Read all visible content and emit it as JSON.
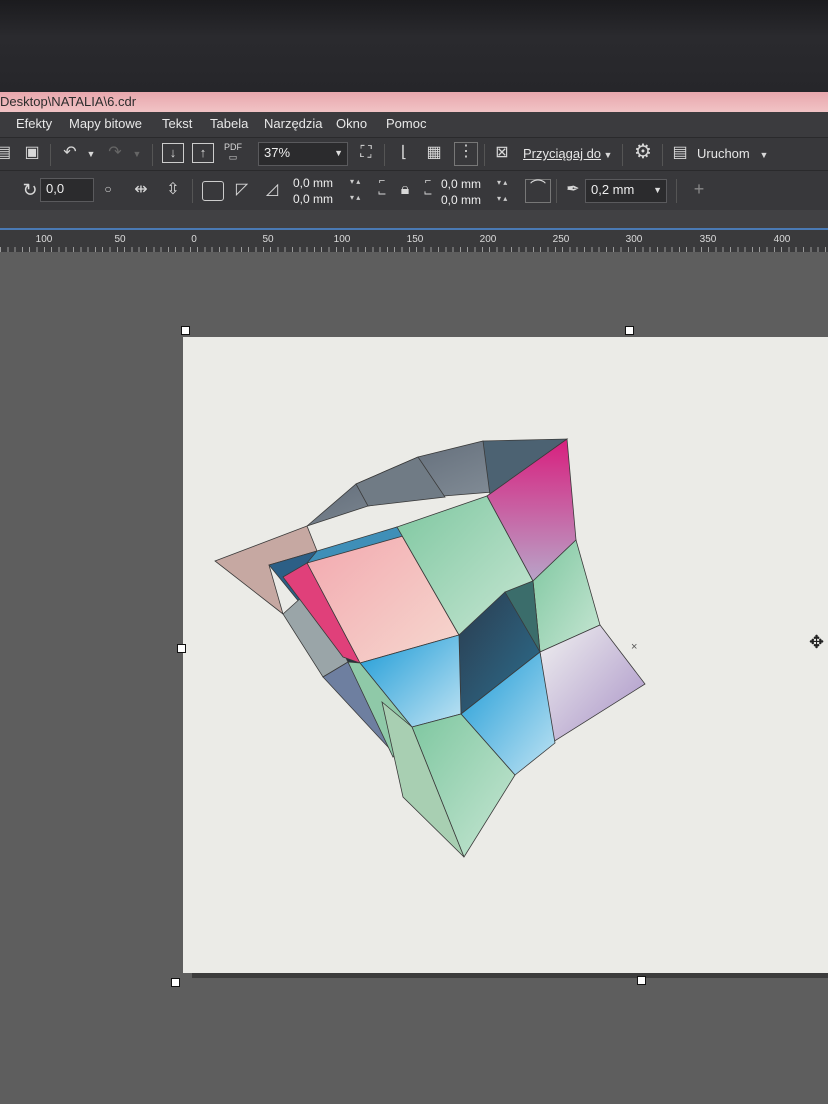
{
  "window": {
    "title": "Desktop\\NATALIA\\6.cdr"
  },
  "menubar": {
    "items": [
      "Efekty",
      "Mapy bitowe",
      "Tekst",
      "Tabela",
      "Narzędzia",
      "Okno",
      "Pomoc"
    ]
  },
  "toolbar": {
    "zoom_value": "37%",
    "snap_label": "Przyciągaj do",
    "launch_label": "Uruchom",
    "pdf_label": "PDF"
  },
  "property_bar": {
    "rotation": "0,0",
    "offset_x": "0,0 mm",
    "offset_y": "0,0 mm",
    "corner_x": "0,0 mm",
    "corner_y": "0,0 mm",
    "outline_width": "0,2 mm"
  },
  "ruler": {
    "labels": [
      "100",
      "50",
      "0",
      "50",
      "100",
      "150",
      "200",
      "250",
      "300",
      "350",
      "400"
    ]
  },
  "colors": {
    "accent": "#4a7ab5",
    "page": "#ebebe7",
    "workspace": "#5e5e5e"
  },
  "icons": {
    "copy": "copy-icon",
    "paste": "paste-icon",
    "undo": "undo-icon",
    "redo": "redo-icon",
    "import": "import-icon",
    "export": "export-icon",
    "full_screen": "full-screen-icon",
    "settings": "gear-icon",
    "move_cursor": "move-cursor-icon"
  }
}
